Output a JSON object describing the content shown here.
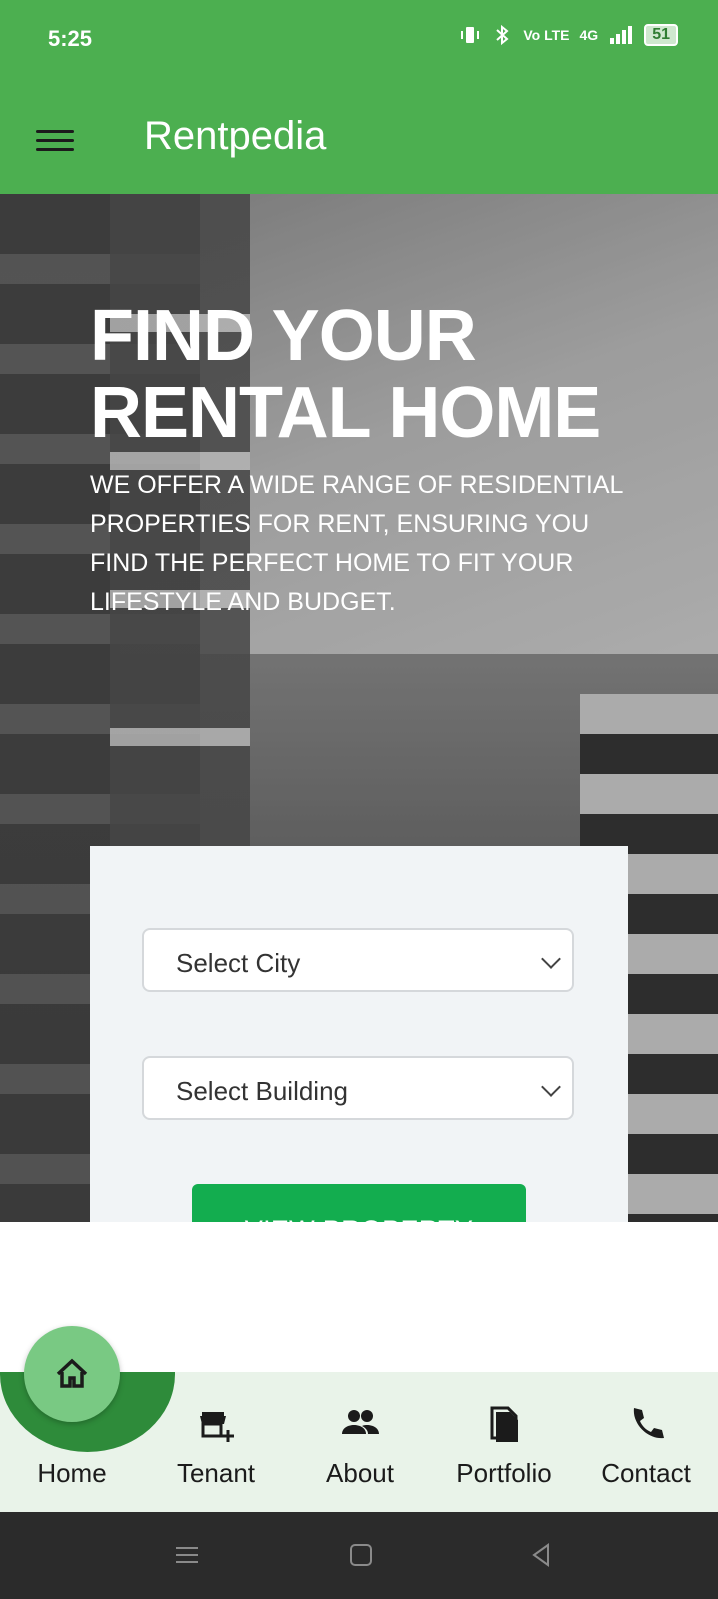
{
  "status_bar": {
    "time": "5:25",
    "network": "4G",
    "volte": "Vo LTE",
    "battery": "51"
  },
  "app_bar": {
    "title": "Rentpedia"
  },
  "hero": {
    "title_line1": "FIND YOUR",
    "title_line2": "RENTAL HOME",
    "subtitle": "WE OFFER A WIDE RANGE OF RESIDENTIAL PROPERTIES FOR RENT, ENSURING YOU FIND THE PERFECT HOME TO FIT YOUR LIFESTYLE AND BUDGET."
  },
  "search_form": {
    "city_select": "Select City",
    "building_select": "Select Building",
    "view_button": "VIEW PROPERTY"
  },
  "bottom_nav": {
    "items": [
      {
        "label": "Home",
        "icon": "home-icon",
        "active": true
      },
      {
        "label": "Tenant",
        "icon": "store-add-icon"
      },
      {
        "label": "About",
        "icon": "people-icon"
      },
      {
        "label": "Portfolio",
        "icon": "documents-icon"
      },
      {
        "label": "Contact",
        "icon": "phone-icon"
      }
    ]
  },
  "colors": {
    "brand_green": "#4caf50",
    "button_green": "#13ad4f",
    "nav_bg": "#e9f3e9",
    "active_dark": "#2e8b3a",
    "active_light": "#79c983"
  }
}
